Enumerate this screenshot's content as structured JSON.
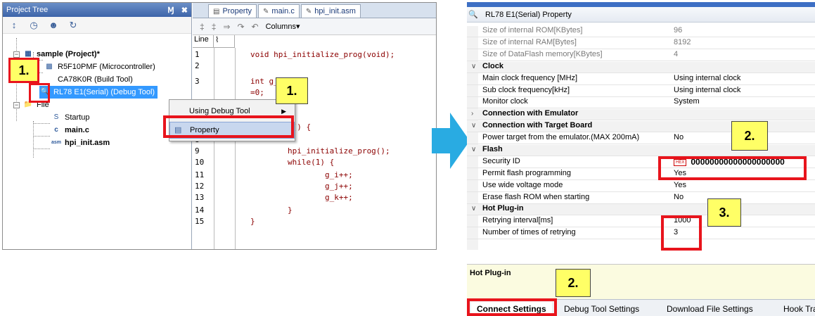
{
  "left_ide": {
    "project_tree": {
      "title": "Project Tree",
      "pin": "Ɱ",
      "close": "✖",
      "items": [
        {
          "label": "sample (Project)*"
        },
        {
          "label": "R5F10PMF (Microcontroller)"
        },
        {
          "label": "CA78K0R (Build Tool)"
        },
        {
          "label": "RL78 E1(Serial) (Debug Tool)"
        },
        {
          "label": "File"
        },
        {
          "label": "Startup"
        },
        {
          "label": "main.c"
        },
        {
          "label": "hpi_init.asm"
        }
      ]
    },
    "editor": {
      "tabs": [
        {
          "label": "Property"
        },
        {
          "label": "main.c"
        },
        {
          "label": "hpi_init.asm"
        }
      ],
      "columns_label": "Columns▾",
      "line_header": "Line",
      "lines": [
        {
          "n": "1",
          "code": "void hpi_initialize_prog(void);"
        },
        {
          "n": "2",
          "code": ""
        },
        {
          "n": "3",
          "code": "int g_"
        },
        {
          "n": "",
          "code": "=0;"
        },
        {
          "n": "",
          "code": "=0;"
        },
        {
          "n": "",
          "code": ""
        },
        {
          "n": "",
          "code": "void main() {"
        },
        {
          "n": "8",
          "code": ""
        },
        {
          "n": "9",
          "code": "        hpi_initialize_prog();"
        },
        {
          "n": "10",
          "code": "        while(1) {"
        },
        {
          "n": "11",
          "code": "                g_i++;"
        },
        {
          "n": "12",
          "code": "                g_j++;"
        },
        {
          "n": "13",
          "code": "                g_k++;"
        },
        {
          "n": "14",
          "code": "        }"
        },
        {
          "n": "15",
          "code": "}"
        }
      ]
    },
    "context_menu": {
      "items": [
        {
          "label": "Using Debug Tool",
          "arrow": "▶"
        },
        {
          "label": "Property"
        }
      ]
    }
  },
  "callouts": {
    "c1a": "1.",
    "c1b": "1.",
    "c2a": "2.",
    "c2b": "2.",
    "c3": "3."
  },
  "property_panel": {
    "title": "RL78 E1(Serial) Property",
    "rows": [
      {
        "name": "Size of internal ROM[KBytes]",
        "value": "96"
      },
      {
        "name": "Size of internal RAM[Bytes]",
        "value": "8192"
      },
      {
        "name": "Size of DataFlash memory[KBytes]",
        "value": "4"
      },
      {
        "name": "Clock",
        "value": ""
      },
      {
        "name": "Main clock frequency [MHz]",
        "value": "Using internal clock"
      },
      {
        "name": "Sub clock frequency[kHz]",
        "value": "Using internal clock"
      },
      {
        "name": "Monitor clock",
        "value": "System"
      },
      {
        "name": "Connection with Emulator",
        "value": ""
      },
      {
        "name": "Connection with Target Board",
        "value": ""
      },
      {
        "name": "Power target from the emulator.(MAX 200mA)",
        "value": "No"
      },
      {
        "name": "Flash",
        "value": ""
      },
      {
        "name": "Security ID",
        "value": "00000000000000000000",
        "tag": "HEX"
      },
      {
        "name": "Permit flash programming",
        "value": "Yes"
      },
      {
        "name": "Use wide voltage mode",
        "value": "Yes"
      },
      {
        "name": "Erase flash ROM when starting",
        "value": "No"
      },
      {
        "name": "Hot Plug-in",
        "value": ""
      },
      {
        "name": "Retrying  interval[ms]",
        "value": "1000"
      },
      {
        "name": "Number of times of retrying",
        "value": "3"
      }
    ],
    "description_title": "Hot Plug-in",
    "bottom_tabs": [
      {
        "label": "Connect Settings"
      },
      {
        "label": "Debug Tool Settings"
      },
      {
        "label": "Download File Settings"
      },
      {
        "label": "Hook Tra"
      }
    ]
  },
  "colors": {
    "highlight_red": "#e8141c",
    "callout_yellow": "#ffff66",
    "arrow_blue": "#29abe2",
    "selection_blue": "#3399ff"
  }
}
